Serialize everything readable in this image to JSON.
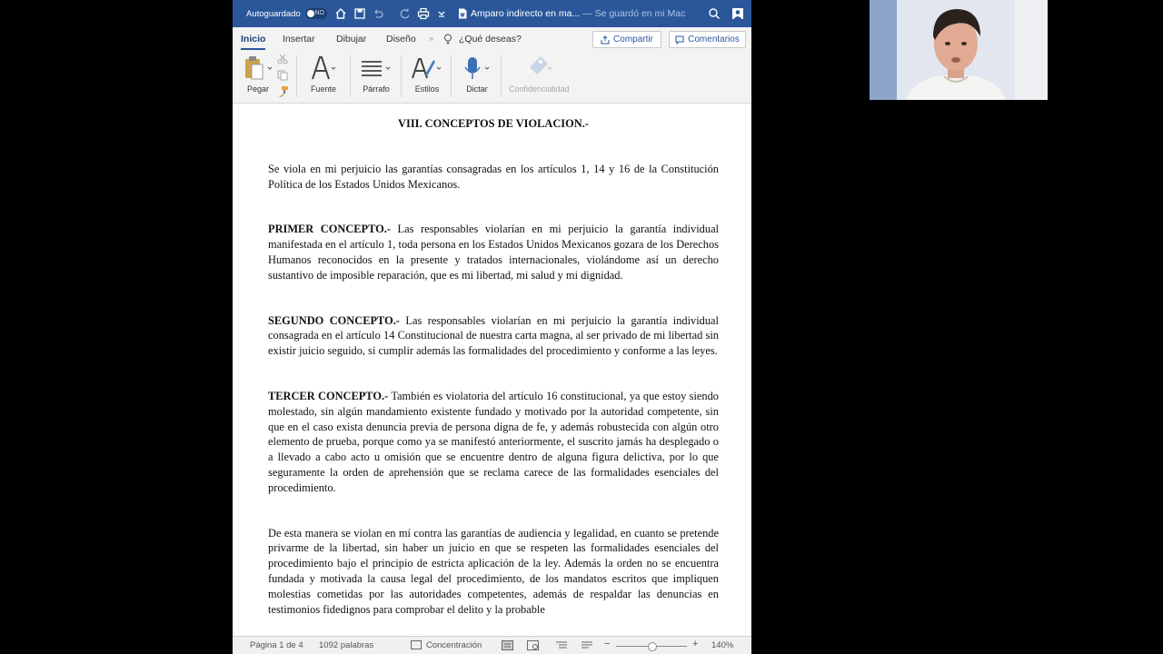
{
  "titlebar": {
    "autosave_label": "Autoguardado",
    "autosave_state": "NO",
    "doc_name": "Amparo indirecto en ma...",
    "saved_status": "— Se guardó en mi Mac",
    "color": "#2b579a"
  },
  "ribbon": {
    "tabs": [
      {
        "label": "Inicio"
      },
      {
        "label": "Insertar"
      },
      {
        "label": "Dibujar"
      },
      {
        "label": "Diseño"
      }
    ],
    "tell_me": "¿Qué deseas?",
    "share": "Compartir",
    "comments": "Comentarios",
    "tools": {
      "paste": "Pegar",
      "font": "Fuente",
      "paragraph": "Párrafo",
      "styles": "Estilos",
      "dictate": "Dictar",
      "sensitivity": "Confidencialidad"
    }
  },
  "document": {
    "heading": "VIII. CONCEPTOS DE VIOLACION.-",
    "intro": "Se viola en mi perjuicio las garantías consagradas en los artículos 1, 14 y 16 de la Constitución Política de los Estados Unidos Mexicanos.",
    "concept1_title": "PRIMER CONCEPTO.-",
    "concept1_text": " Las responsables violarían en mi perjuicio la garantía individual manifestada en el artículo 1, toda persona en los Estados Unidos Mexicanos gozara de los Derechos Humanos reconocidos en la presente y tratados internacionales, violándome así un derecho sustantivo de imposible reparación, que es mi libertad, mi salud y mi dignidad.",
    "concept2_title": "SEGUNDO CONCEPTO.-",
    "concept2_text": " Las responsables violarían en mi perjuicio la garantía individual consagrada en el artículo 14 Constitucional de nuestra carta magna, al ser privado de mi libertad sin existir juicio seguido, si cumplir además las formalidades del procedimiento y conforme a las leyes.",
    "concept3_title": "TERCER CONCEPTO.-",
    "concept3_text": " También es violatoria del artículo 16 constitucional, ya que estoy siendo molestado, sin algún mandamiento existente fundado y motivado por la autoridad competente, sin que en el caso exista denuncia previa de persona digna de fe, y además robustecida con algún otro elemento de prueba, porque como ya se manifestó anteriormente, el suscrito jamás ha desplegado o a llevado a cabo acto u omisión que se encuentre dentro de alguna figura delictiva, por lo que seguramente la orden de aprehensión que se reclama carece de las formalidades esenciales del procedimiento.",
    "closing": "De esta manera se violan en mí contra las garantías de audiencia y legalidad, en cuanto se pretende privarme de la libertad, sin haber un juicio en que se respeten las formalidades esenciales del procedimiento bajo el principio de estricta aplicación de la ley. Además la orden no se encuentra fundada y motivada la causa legal del procedimiento, de los mandatos escritos que impliquen molestias cometidas por las autoridades competentes, además de respaldar las denuncias en testimonios fidedignos para comprobar el delito y la probable"
  },
  "statusbar": {
    "page": "Página 1 de 4",
    "words": "1092 palabras",
    "focus": "Concentración",
    "zoom_minus": "−",
    "zoom_plus": "+",
    "zoom": "140%",
    "zoom_level": 0.5
  }
}
